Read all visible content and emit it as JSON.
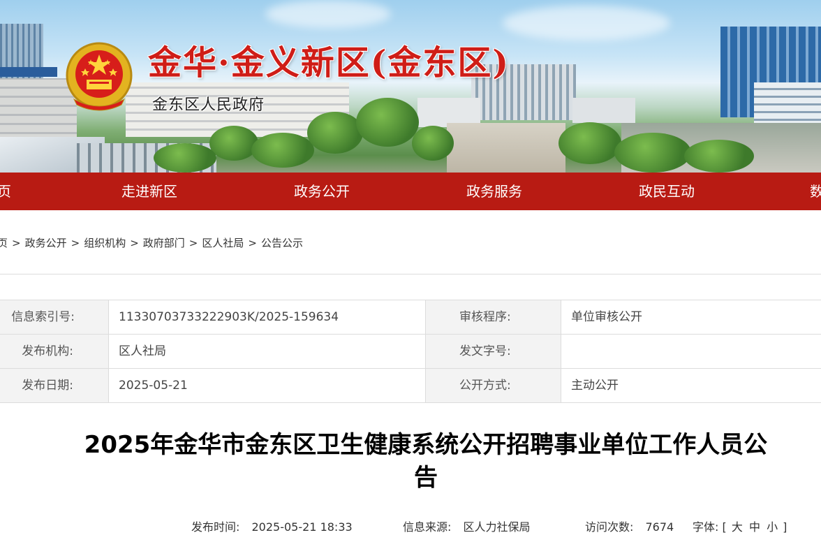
{
  "banner": {
    "title": "金华·金义新区(金东区)",
    "subtitle": "金东区人民政府",
    "emblem_icon": "national-emblem-icon"
  },
  "nav": {
    "items": [
      "页",
      "走进新区",
      "政务公开",
      "政务服务",
      "政民互动",
      "数"
    ]
  },
  "breadcrumb": {
    "items": [
      "页",
      "政务公开",
      "组织机构",
      "政府部门",
      "区人社局",
      "公告公示"
    ],
    "separator": ">"
  },
  "info": {
    "rows": [
      {
        "label1": "信息索引号:",
        "value1": "11330703733222903K/2025-159634",
        "label2": "审核程序:",
        "value2": "单位审核公开"
      },
      {
        "label1": "发布机构:",
        "value1": "区人社局",
        "label2": "发文字号:",
        "value2": ""
      },
      {
        "label1": "发布日期:",
        "value1": "2025-05-21",
        "label2": "公开方式:",
        "value2": "主动公开"
      }
    ]
  },
  "article": {
    "title": "2025年金华市金东区卫生健康系统公开招聘事业单位工作人员公告"
  },
  "meta": {
    "publish_label": "发布时间:",
    "publish_time": "2025-05-21 18:33",
    "source_label": "信息来源:",
    "source": "区人力社保局",
    "visits_label": "访问次数:",
    "visits": "7674",
    "font_label": "字体:",
    "font_open": "[",
    "font_large": "大",
    "font_medium": "中",
    "font_small": "小",
    "font_close": "]"
  },
  "colors": {
    "nav_bg": "#b81b13",
    "title_red": "#cf1d17"
  }
}
